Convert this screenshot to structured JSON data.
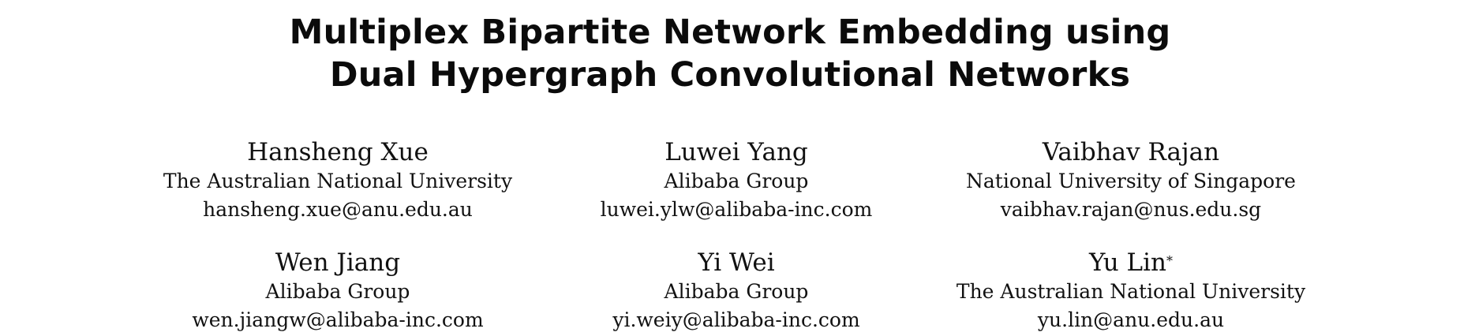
{
  "paper": {
    "title_line_1": "Multiplex Bipartite Network Embedding using",
    "title_line_2": "Dual Hypergraph Convolutional Networks"
  },
  "authors": [
    {
      "name": "Hansheng Xue",
      "marker": "",
      "affiliation": "The Australian National University",
      "email": "hansheng.xue@anu.edu.au"
    },
    {
      "name": "Luwei Yang",
      "marker": "",
      "affiliation": "Alibaba Group",
      "email": "luwei.ylw@alibaba-inc.com"
    },
    {
      "name": "Vaibhav Rajan",
      "marker": "",
      "affiliation": "National University of Singapore",
      "email": "vaibhav.rajan@nus.edu.sg"
    },
    {
      "name": "Wen Jiang",
      "marker": "",
      "affiliation": "Alibaba Group",
      "email": "wen.jiangw@alibaba-inc.com"
    },
    {
      "name": "Yi Wei",
      "marker": "",
      "affiliation": "Alibaba Group",
      "email": "yi.weiy@alibaba-inc.com"
    },
    {
      "name": "Yu Lin",
      "marker": "*",
      "affiliation": "The Australian National University",
      "email": "yu.lin@anu.edu.au"
    }
  ]
}
